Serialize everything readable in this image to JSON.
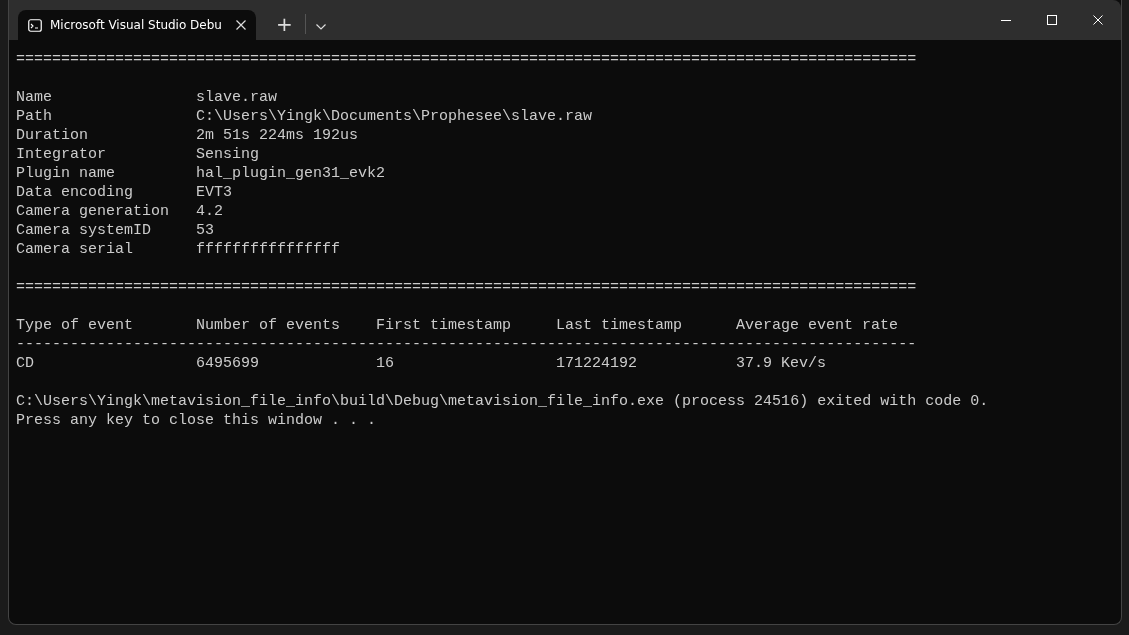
{
  "window": {
    "tab": {
      "title": "Microsoft Visual Studio Debu",
      "selected": true
    },
    "new_tab": "+"
  },
  "console": {
    "separator_top": "====================================================================================================",
    "info": [
      {
        "label": "Name",
        "value": "slave.raw"
      },
      {
        "label": "Path",
        "value": "C:\\Users\\Yingk\\Documents\\Prophesee\\slave.raw"
      },
      {
        "label": "Duration",
        "value": "2m 51s 224ms 192us"
      },
      {
        "label": "Integrator",
        "value": "Sensing"
      },
      {
        "label": "Plugin name",
        "value": "hal_plugin_gen31_evk2"
      },
      {
        "label": "Data encoding",
        "value": "EVT3"
      },
      {
        "label": "Camera generation",
        "value": "4.2"
      },
      {
        "label": "Camera systemID",
        "value": "53"
      },
      {
        "label": "Camera serial",
        "value": "ffffffffffffffff"
      }
    ],
    "separator_middle": "====================================================================================================",
    "table": {
      "columns": [
        "Type of event",
        "Number of events",
        "First timestamp",
        "Last timestamp",
        "Average event rate"
      ],
      "rule": "----------------------------------------------------------------------------------------------------",
      "rows": [
        [
          "CD",
          "6495699",
          "16",
          "171224192",
          "37.9 Kev/s"
        ]
      ]
    },
    "footer": [
      "C:\\Users\\Yingk\\metavision_file_info\\build\\Debug\\metavision_file_info.exe (process 24516) exited with code 0.",
      "Press any key to close this window . . ."
    ]
  }
}
